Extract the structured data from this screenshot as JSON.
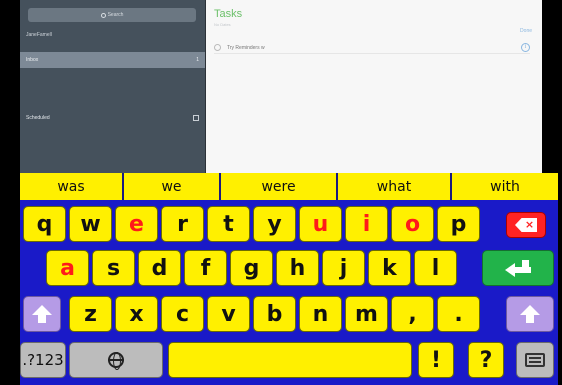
{
  "app": {
    "search_placeholder": "Search",
    "sidebar_account": "JaneFamell",
    "sidebar_selected": "Inbox",
    "sidebar_selected_count": "1",
    "sidebar_scheduled": "Scheduled",
    "title": "Tasks",
    "subtitle": "No Dates",
    "done_label": "Done",
    "task_item": "Try Reminders w"
  },
  "suggestions": [
    "was",
    "we",
    "were",
    "what",
    "with"
  ],
  "keyboard": {
    "row1": [
      "q",
      "w",
      "e",
      "r",
      "t",
      "y",
      "u",
      "i",
      "o",
      "p"
    ],
    "row2": [
      "a",
      "s",
      "d",
      "f",
      "g",
      "h",
      "j",
      "k",
      "l"
    ],
    "row3": [
      "z",
      "x",
      "c",
      "v",
      "b",
      "n",
      "m",
      ",",
      "."
    ],
    "numbers_label": ".?123",
    "exclaim_label": "!",
    "question_label": "?",
    "vowel_color": "#ff1a1a",
    "key_color": "#fff000",
    "board_color": "#1a1ac8",
    "icons": {
      "delete": "backspace-icon",
      "enter": "return-icon",
      "shift": "shift-arrow-icon",
      "globe": "globe-icon",
      "hide": "keyboard-hide-icon"
    }
  }
}
